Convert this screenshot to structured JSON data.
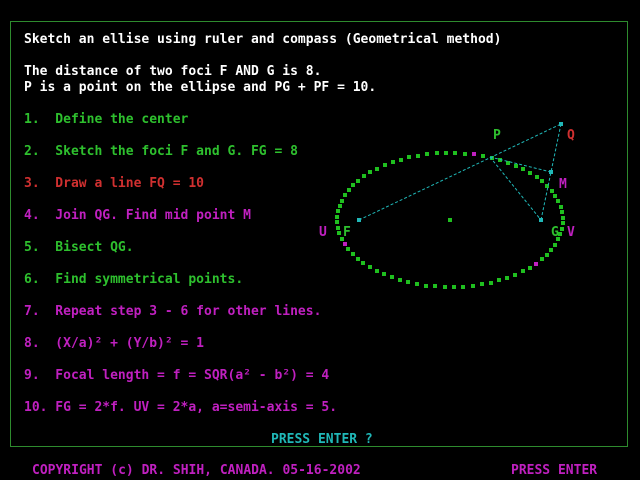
{
  "title": "Sketch an ellise using ruler and compass (Geometrical method)",
  "intro": [
    "The distance of two foci F AND G is 8.",
    "P is a point on the ellipse and PG + PF = 10."
  ],
  "steps": [
    {
      "text": "1.  Define the center",
      "color": "#2ec02e"
    },
    {
      "text": "2.  Sketch the foci F and G. FG = 8",
      "color": "#2ec02e"
    },
    {
      "text": "3.  Draw a line FQ = 10",
      "color": "#d03030"
    },
    {
      "text": "4.  Join QG. Find mid point M",
      "color": "#c020c0"
    },
    {
      "text": "5.  Bisect QG.",
      "color": "#2ec02e"
    },
    {
      "text": "6.  Find symmetrical points.",
      "color": "#2ec02e"
    },
    {
      "text": "7.  Repeat step 3 - 6 for other lines.",
      "color": "#c020c0"
    },
    {
      "text": "8.  (X/a)² + (Y/b)² = 1",
      "color": "#c020c0"
    },
    {
      "text": "9.  Focal length = f = SQR(a² - b²) = 4",
      "color": "#c020c0"
    },
    {
      "text": "10. FG = 2*f. UV = 2*a, a=semi-axis = 5.",
      "color": "#c020c0"
    }
  ],
  "diagram_labels": {
    "P": "P",
    "Q": "Q",
    "M": "M",
    "U": "U",
    "F": "F",
    "G": "G",
    "V": "V"
  },
  "prompt": "PRESS ENTER ?",
  "footer": {
    "copyright": "COPYRIGHT (c) DR. SHIH, CANADA. 05-16-2002",
    "press_enter": "PRESS ENTER"
  },
  "colors": {
    "background": "#000000",
    "frame": "#2e8b2e",
    "ellipse_dots": "#1fbf1f",
    "highlight_dots": "#c020c0",
    "construction_lines": "#20b8b8",
    "label_green": "#2ec02e",
    "label_red": "#d03030",
    "label_magenta": "#c020c0"
  }
}
